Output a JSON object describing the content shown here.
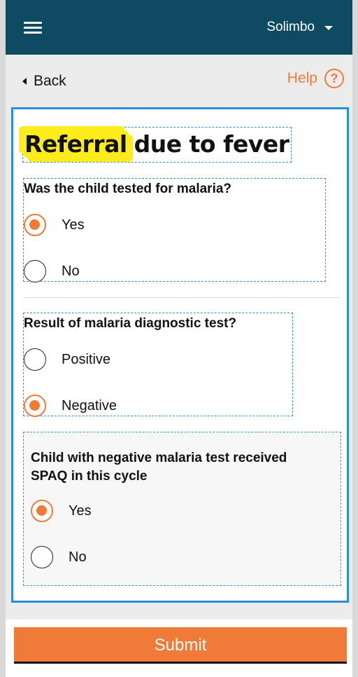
{
  "header": {
    "user_name": "Solimbo"
  },
  "nav": {
    "back_label": "Back",
    "help_label": "Help",
    "help_icon_glyph": "?"
  },
  "form": {
    "title_highlight": "Referral",
    "title_rest": "due to fever",
    "questions": [
      {
        "text": "Was the child tested for malaria?",
        "options": [
          {
            "label": "Yes",
            "checked": true
          },
          {
            "label": "No",
            "checked": false
          }
        ]
      },
      {
        "text": "Result of malaria diagnostic test?",
        "options": [
          {
            "label": "Positive",
            "checked": false
          },
          {
            "label": "Negative",
            "checked": true
          }
        ]
      },
      {
        "text": "Child with negative malaria test received SPAQ in this cycle",
        "options": [
          {
            "label": "Yes",
            "checked": true
          },
          {
            "label": "No",
            "checked": false
          }
        ]
      }
    ],
    "submit_label": "Submit"
  },
  "colors": {
    "header_bg": "#0f4a63",
    "accent": "#f07a37",
    "card_border": "#2a8fd6",
    "highlight": "#ffec1a"
  }
}
